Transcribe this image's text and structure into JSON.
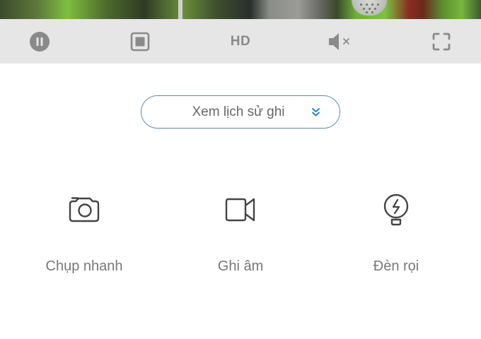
{
  "video": {
    "icon": "camera-feed-preview"
  },
  "toolbar": {
    "pause_icon": "pause-icon",
    "stop_icon": "stop-icon",
    "quality_label": "HD",
    "mute_icon": "speaker-muted-icon",
    "fullscreen_icon": "fullscreen-icon",
    "icon_color": "#8a8a8a",
    "background": "#e6e6e6"
  },
  "history": {
    "label": "Xem lịch sử ghi",
    "icon": "double-chevron-down-icon",
    "border_color": "#5b8ca8",
    "accent_color": "#2d7fd6"
  },
  "actions": [
    {
      "label": "Chụp nhanh",
      "icon": "camera-icon"
    },
    {
      "label": "Ghi âm",
      "icon": "video-record-icon"
    },
    {
      "label": "Đèn rọi",
      "icon": "lightbulb-icon"
    }
  ]
}
